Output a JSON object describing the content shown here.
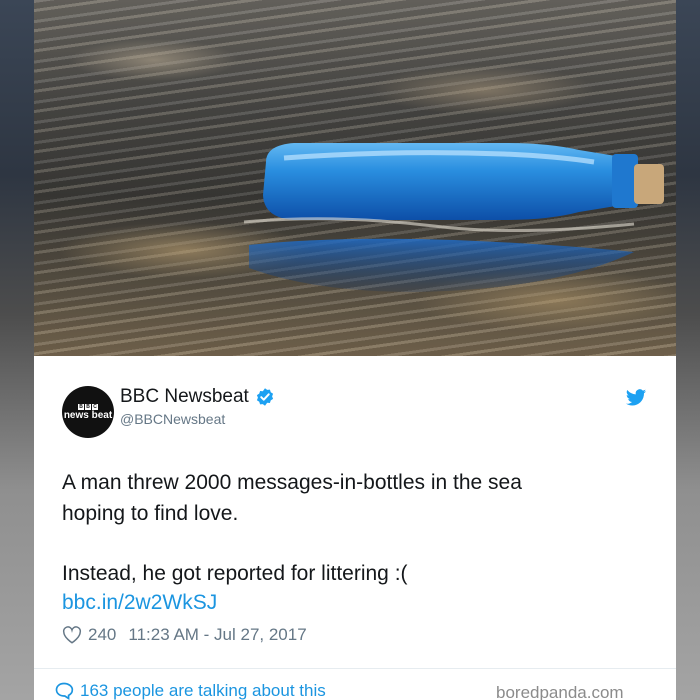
{
  "photo": {
    "subject_icon": "blue-bottle-in-water"
  },
  "tweet": {
    "account_name": "BBC Newsbeat",
    "handle": "@BBCNewsbeat",
    "avatar_text": "news beat",
    "avatar_blocks": [
      "B",
      "B",
      "C"
    ],
    "verified_icon": "verified-badge-icon",
    "brand_icon": "twitter-bird-icon",
    "text_line1": "A man threw 2000 messages-in-bottles in the sea",
    "text_line2": "hoping to find love.",
    "text_line3": "Instead, he got reported for littering :(",
    "link": "bbc.in/2w2WkSJ",
    "likes": "240",
    "timestamp": "11:23 AM - Jul 27, 2017",
    "talking": "163 people are talking about this",
    "credit": "boredpanda.com"
  },
  "colors": {
    "twitter_blue": "#1b95e0",
    "text": "#14171a",
    "muted": "#657786"
  }
}
